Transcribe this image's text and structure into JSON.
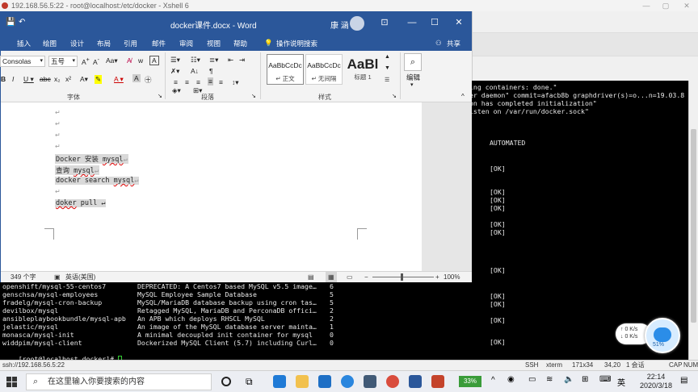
{
  "xshell": {
    "title": "192.168.56.5:22 - root@localhost:/etc/docker - Xshell 6",
    "right_lines": [
      "ing containers: done.\"",
      "er daemon\" commit=afacb8b graphdriver(s)=o...n=19.03.8",
      "on has completed initialization\"",
      "isten on /var/run/docker.sock\""
    ],
    "automated_header": "AUTOMATED",
    "ok_label": "[OK]",
    "search_rows": [
      {
        "name": "openshift/mysql-55-centos7",
        "desc": "DEPRECATED: A Centos7 based MySQL v5.5 image…",
        "stars": "6"
      },
      {
        "name": "genschsa/mysql-employees",
        "desc": "MySQL Employee Sample Database",
        "stars": "5"
      },
      {
        "name": "fradelg/mysql-cron-backup",
        "desc": "MySQL/MariaDB database backup using cron tas…",
        "stars": "5"
      },
      {
        "name": "devilbox/mysql",
        "desc": "Retagged MySQL, MariaDB and PerconaDB offici…",
        "stars": "2"
      },
      {
        "name": "ansibleplaybookbundle/mysql-apb",
        "desc": "An APB which deploys RHSCL MySQL",
        "stars": "2"
      },
      {
        "name": "jelastic/mysql",
        "desc": "An image of the MySQL database server mainta…",
        "stars": "1"
      },
      {
        "name": "monasca/mysql-init",
        "desc": "A minimal decoupled init container for mysql",
        "stars": "0"
      },
      {
        "name": "widdpim/mysql-client",
        "desc": "Dockerized MySQL Client (5.7) including Curl…",
        "stars": "0"
      }
    ],
    "prompt": "[root@localhost docker]# ",
    "status": {
      "conn": "ssh://192.168.56.5:22",
      "proto": "SSH",
      "term": "xterm",
      "size": "171x34",
      "pos": "34,20",
      "sessions": "1 会话",
      "caps": "CAP",
      "num": "NUM"
    }
  },
  "word": {
    "title": "docker课件.docx  -  Word",
    "user": "康 涵",
    "menu": [
      "插入",
      "绘图",
      "设计",
      "布局",
      "引用",
      "邮件",
      "审阅",
      "视图",
      "帮助",
      "操作说明搜索",
      "共享"
    ],
    "font_name": "Consolas",
    "font_size": "五号",
    "groups": {
      "font": "字体",
      "paragraph": "段落",
      "styles": "样式",
      "edit": "编辑"
    },
    "styles": [
      {
        "sample": "AaBbCcDc",
        "name": "↵ 正文"
      },
      {
        "sample": "AaBbCcDc",
        "name": "↵ 无间隔"
      },
      {
        "sample": "AaBl",
        "name": "标题 1"
      }
    ],
    "doc_lines": [
      {
        "pre": "Docker 安装 ",
        "mark": "mysql",
        "post": "↵"
      },
      {
        "pre": "查询 ",
        "mark": "mysql",
        "post": "↵"
      },
      {
        "pre": "docker search ",
        "mark": "mysql",
        "post": "↵"
      },
      {
        "pre": "",
        "mark": "doker",
        "post": " pull ↵"
      }
    ],
    "para_mark": "↵",
    "status": {
      "words": "349 个字",
      "lang": "英语(美国)",
      "zoom": "100%"
    }
  },
  "taskbar": {
    "search_placeholder": "在这里输入你要搜索的内容",
    "battery": "33%",
    "ime": "英",
    "time": "22:14",
    "date": "2020/3/18"
  },
  "net_widget": {
    "up": "0  K/s",
    "down": "0  K/s",
    "percent": "51%"
  },
  "colors": {
    "word_blue": "#2b579a",
    "terminal_bg": "#000000",
    "terminal_fg": "#e8e8e8"
  }
}
